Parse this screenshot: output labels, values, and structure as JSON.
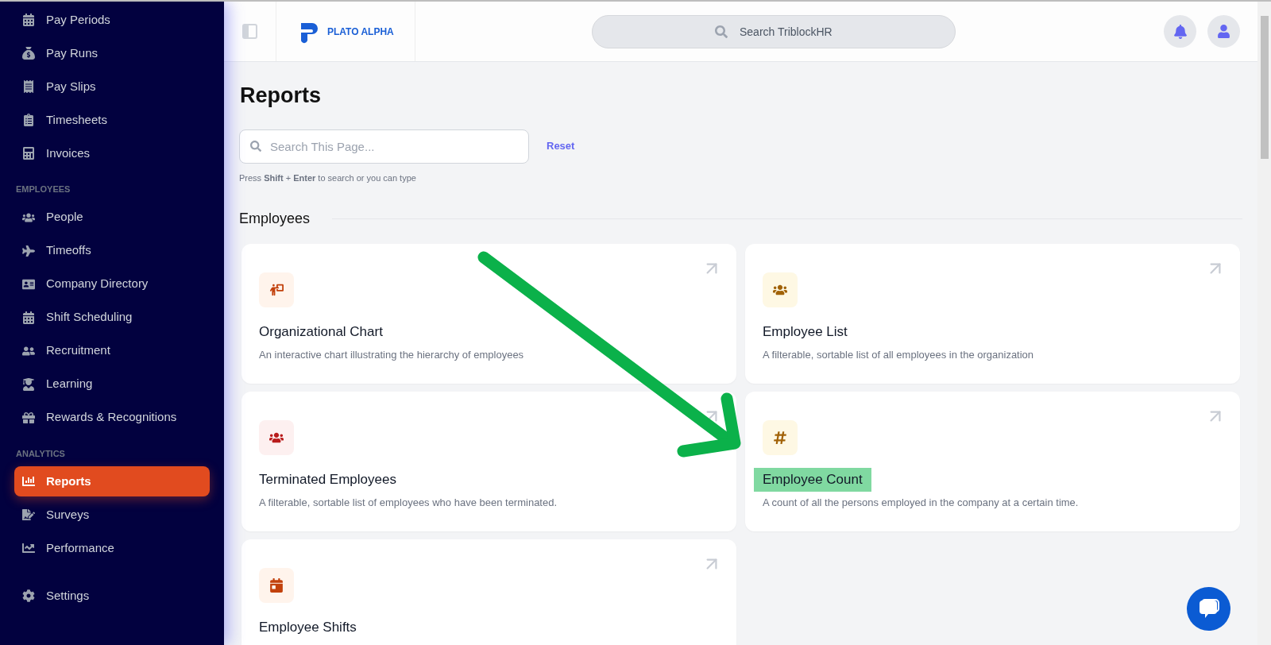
{
  "sidebar": {
    "sections": [
      {
        "items": [
          {
            "label": "Pay Periods",
            "selected": false
          },
          {
            "label": "Pay Runs",
            "selected": false
          },
          {
            "label": "Pay Slips",
            "selected": false
          },
          {
            "label": "Timesheets",
            "selected": false
          },
          {
            "label": "Invoices",
            "selected": false
          }
        ]
      },
      {
        "heading": "EMPLOYEES",
        "items": [
          {
            "label": "People",
            "selected": false
          },
          {
            "label": "Timeoffs",
            "selected": false
          },
          {
            "label": "Company Directory",
            "selected": false
          },
          {
            "label": "Shift Scheduling",
            "selected": false
          },
          {
            "label": "Recruitment",
            "selected": false
          },
          {
            "label": "Learning",
            "selected": false
          },
          {
            "label": "Rewards & Recognitions",
            "selected": false
          }
        ]
      },
      {
        "heading": "ANALYTICS",
        "items": [
          {
            "label": "Reports",
            "selected": true
          },
          {
            "label": "Surveys",
            "selected": false
          },
          {
            "label": "Performance",
            "selected": false
          }
        ]
      },
      {
        "items": [
          {
            "label": "Settings",
            "selected": false
          }
        ]
      }
    ]
  },
  "header": {
    "logo": "PLATO ALPHA",
    "search": {
      "placeholder": "Search TriblockHR"
    }
  },
  "page": {
    "title": "Reports",
    "search": {
      "placeholder": "Search This Page..."
    },
    "reset": "Reset",
    "hint": "Press **Shift** + **Enter** to search or you can type",
    "section": "Employees",
    "cards": [
      {
        "title": "Organizational Chart",
        "description": "An interactive chart illustrating the hierarchy of employees",
        "highlighted": false
      },
      {
        "title": "Employee List",
        "description": "A filterable, sortable list of all employees in the organization",
        "highlighted": false
      },
      {
        "title": "Terminated Employees",
        "description": "A filterable, sortable list of employees who have been terminated.",
        "highlighted": false
      },
      {
        "title": "Employee Count",
        "description": "A count of all the persons employed in the company at a certain time.",
        "highlighted": true
      },
      {
        "title": "Employee Shifts",
        "highlighted": false
      }
    ]
  }
}
